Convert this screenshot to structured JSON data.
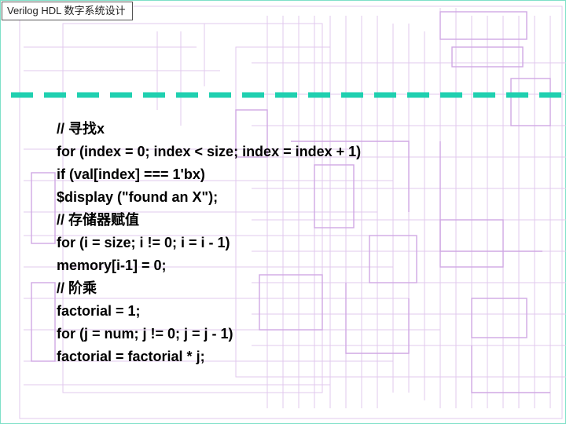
{
  "header": {
    "title": "Verilog HDL 数字系统设计"
  },
  "slide": {
    "divider_color": "#20d0b0",
    "code_lines": [
      "// 寻找x",
      "for (index = 0; index < size; index = index + 1)",
      "if (val[index] === 1'bx)",
      "$display (\"found an X\");",
      "// 存储器赋值",
      "for (i = size; i != 0; i = i - 1)",
      "memory[i-1] = 0;",
      "// 阶乘",
      "factorial = 1;",
      "for (j = num; j != 0; j = j - 1)",
      "factorial = factorial * j;"
    ]
  }
}
